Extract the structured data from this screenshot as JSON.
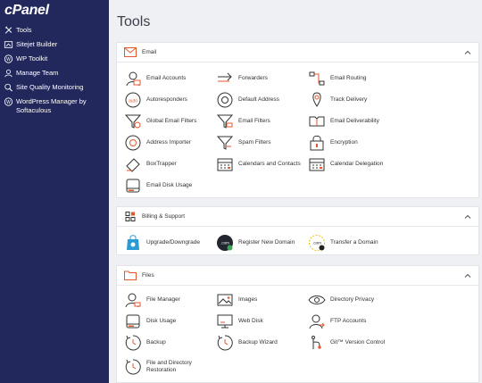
{
  "sidebar": {
    "logo": "cPanel",
    "items": [
      {
        "label": "Tools"
      },
      {
        "label": "Sitejet Builder"
      },
      {
        "label": "WP Toolkit"
      },
      {
        "label": "Manage Team"
      },
      {
        "label": "Site Quality Monitoring"
      },
      {
        "label": "WordPress Manager by Softaculous"
      }
    ]
  },
  "main": {
    "title": "Tools",
    "email": {
      "header": "Email",
      "items": [
        {
          "label": "Email Accounts",
          "icon": "email-accounts-icon"
        },
        {
          "label": "Forwarders",
          "icon": "forwarders-icon"
        },
        {
          "label": "Email Routing",
          "icon": "email-routing-icon"
        },
        {
          "label": "Autoresponders",
          "icon": "autoresponders-icon"
        },
        {
          "label": "Default Address",
          "icon": "default-address-icon"
        },
        {
          "label": "Track Delivery",
          "icon": "track-delivery-icon"
        },
        {
          "label": "Global Email Filters",
          "icon": "global-email-filters-icon"
        },
        {
          "label": "Email Filters",
          "icon": "email-filters-icon"
        },
        {
          "label": "Email Deliverability",
          "icon": "email-deliverability-icon"
        },
        {
          "label": "Address Importer",
          "icon": "address-importer-icon"
        },
        {
          "label": "Spam Filters",
          "icon": "spam-filters-icon"
        },
        {
          "label": "Encryption",
          "icon": "encryption-icon"
        },
        {
          "label": "BoxTrapper",
          "icon": "boxtrapper-icon"
        },
        {
          "label": "Calendars and Contacts",
          "icon": "calendars-contacts-icon"
        },
        {
          "label": "Calendar Delegation",
          "icon": "calendar-delegation-icon"
        },
        {
          "label": "Email Disk Usage",
          "icon": "email-disk-usage-icon"
        }
      ]
    },
    "billing": {
      "header": "Billing & Support",
      "items": [
        {
          "label": "Upgrade/Downgrade",
          "icon": "upgrade-downgrade-icon"
        },
        {
          "label": "Register New Domain",
          "icon": "register-domain-icon",
          "badge": ".com"
        },
        {
          "label": "Transfer a Domain",
          "icon": "transfer-domain-icon",
          "badge": ".com"
        }
      ]
    },
    "files": {
      "header": "Files",
      "items": [
        {
          "label": "File Manager",
          "icon": "file-manager-icon"
        },
        {
          "label": "Images",
          "icon": "images-icon"
        },
        {
          "label": "Directory Privacy",
          "icon": "directory-privacy-icon"
        },
        {
          "label": "Disk Usage",
          "icon": "disk-usage-icon"
        },
        {
          "label": "Web Disk",
          "icon": "web-disk-icon"
        },
        {
          "label": "FTP Accounts",
          "icon": "ftp-accounts-icon"
        },
        {
          "label": "Backup",
          "icon": "backup-icon"
        },
        {
          "label": "Backup Wizard",
          "icon": "backup-wizard-icon"
        },
        {
          "label": "Git™ Version Control",
          "icon": "git-icon"
        },
        {
          "label": "File and Directory Restoration",
          "icon": "file-restoration-icon"
        }
      ]
    }
  },
  "colors": {
    "sidebar_bg": "#23285c",
    "accent_orange": "#e2572c",
    "icon_stroke": "#333333",
    "page_bg": "#eef0f3"
  }
}
